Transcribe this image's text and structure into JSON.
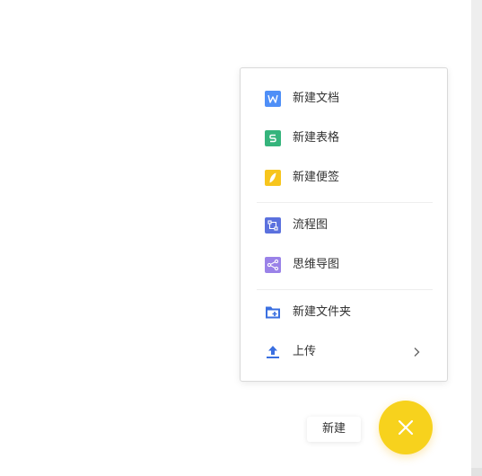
{
  "menu": {
    "items": [
      {
        "label": "新建文档",
        "icon": "word-doc-icon",
        "color": "#4f8ff7"
      },
      {
        "label": "新建表格",
        "icon": "spreadsheet-icon",
        "color": "#35b47c"
      },
      {
        "label": "新建便签",
        "icon": "note-icon",
        "color": "#f7c51d"
      },
      {
        "label": "流程图",
        "icon": "flowchart-icon",
        "color": "#5b71de"
      },
      {
        "label": "思维导图",
        "icon": "mindmap-icon",
        "color": "#9a82e8"
      },
      {
        "label": "新建文件夹",
        "icon": "new-folder-icon",
        "color": "#3a6fe0"
      },
      {
        "label": "上传",
        "icon": "upload-icon",
        "color": "#3a6fe0"
      }
    ]
  },
  "fab": {
    "tooltip": "新建",
    "icon": "close-icon",
    "color": "#f7d21d"
  }
}
